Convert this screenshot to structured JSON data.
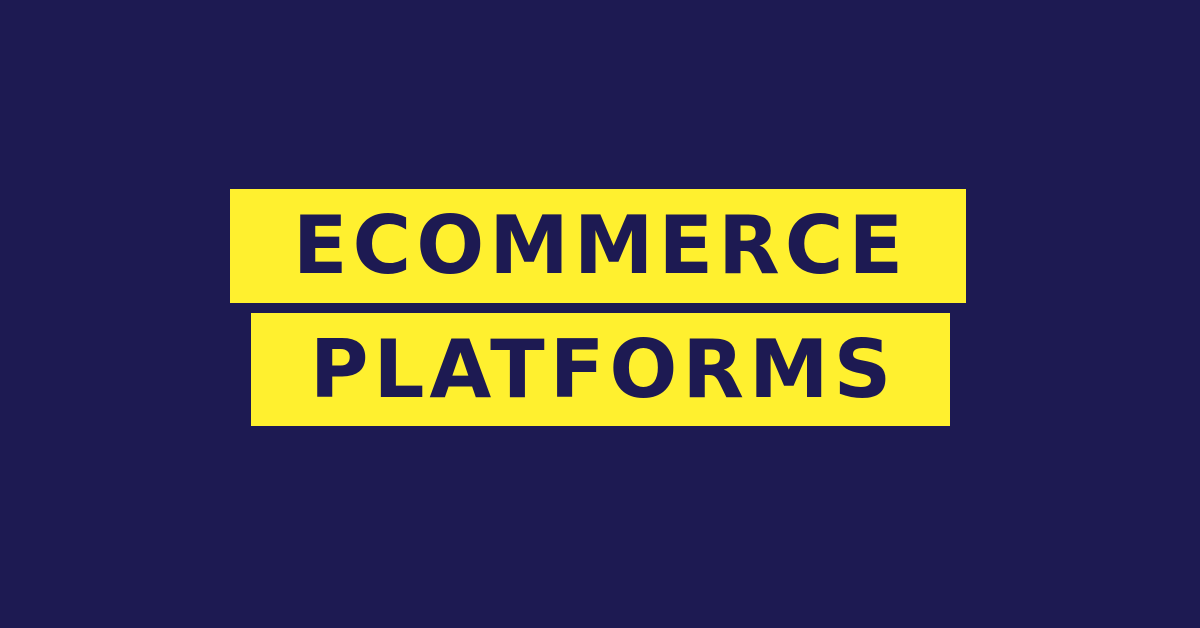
{
  "colors": {
    "background": "#1d1a52",
    "highlight": "#fff02f",
    "text": "#1d1a52"
  },
  "headline": {
    "line1": "ECOMMERCE",
    "line2": "PLATFORMS"
  }
}
